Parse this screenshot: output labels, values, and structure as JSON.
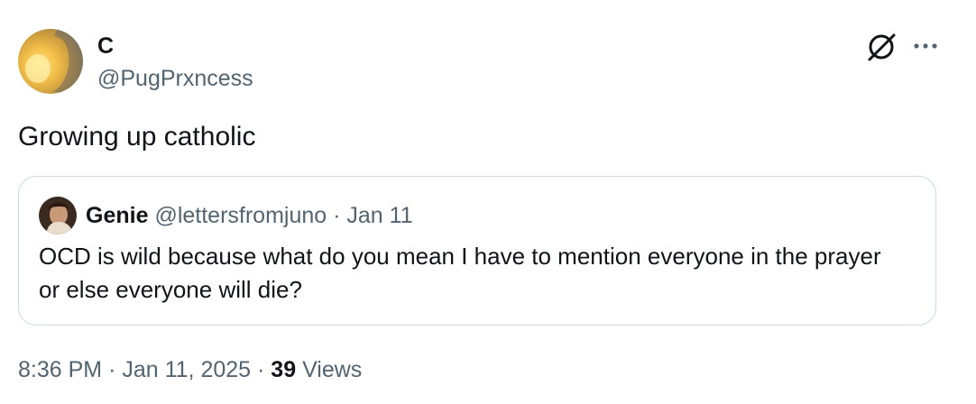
{
  "tweet": {
    "author": {
      "display_name": "C",
      "handle": "@PugPrxncess"
    },
    "text": "Growing up catholic",
    "quote": {
      "author": {
        "display_name": "Genie",
        "handle": "@lettersfromjuno"
      },
      "separator": "·",
      "date": "Jan 11",
      "text": "OCD is wild because what do you mean I have to mention everyone in the prayer or else everyone will die?"
    },
    "meta": {
      "time": "8:36 PM",
      "separator1": "·",
      "date": "Jan 11, 2025",
      "separator2": "·",
      "views_count": "39",
      "views_label": "Views"
    }
  },
  "icons": {
    "grok": "grok-icon",
    "more": "more-icon"
  },
  "colors": {
    "text_primary": "#0f1419",
    "text_secondary": "#536471",
    "border": "#cfd9de"
  }
}
